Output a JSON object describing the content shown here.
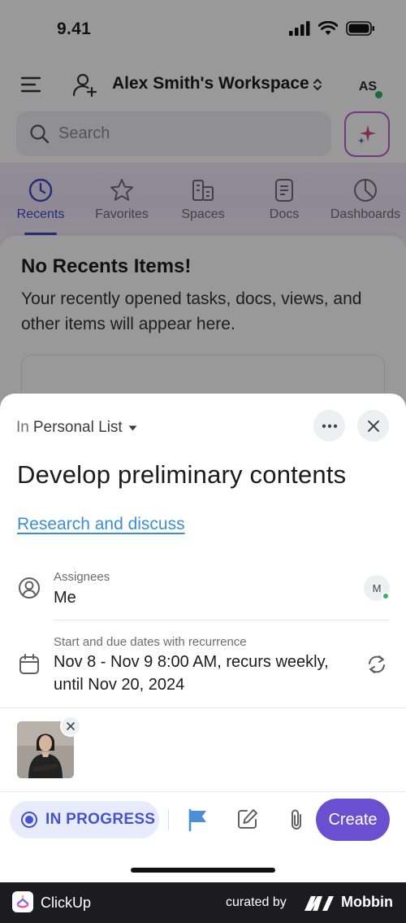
{
  "status_bar": {
    "time": "9.41"
  },
  "workspace": {
    "name": "Alex Smith's Workspace",
    "avatar_initials": "AS"
  },
  "search": {
    "placeholder": "Search"
  },
  "tabs": [
    {
      "label": "Recents",
      "icon": "clock-icon",
      "active": true
    },
    {
      "label": "Favorites",
      "icon": "star-icon",
      "active": false
    },
    {
      "label": "Spaces",
      "icon": "spaces-icon",
      "active": false
    },
    {
      "label": "Docs",
      "icon": "doc-icon",
      "active": false
    },
    {
      "label": "Dashboards",
      "icon": "pie-chart-icon",
      "active": false
    }
  ],
  "recents": {
    "empty_title": "No Recents Items!",
    "empty_description": "Your recently opened tasks, docs, views, and other items will appear here."
  },
  "sheet": {
    "location_prefix": "In",
    "location_name": "Personal List",
    "task_title": "Develop preliminary contents",
    "task_link": "Research and discuss",
    "assignees": {
      "label": "Assignees",
      "value": "Me",
      "avatar_initial": "M"
    },
    "dates": {
      "label": "Start and due dates with recurrence",
      "line1": "Nov 8 - Nov 9 8:00 AM, recurs weekly,",
      "line2": "until Nov 20, 2024"
    },
    "status": "IN PROGRESS",
    "create_label": "Create"
  },
  "footer": {
    "app_name": "ClickUp",
    "curated_by": "curated by",
    "brand": "Mobbin"
  },
  "colors": {
    "accent": "#4454d1",
    "create": "#6a4fd0",
    "link": "#3b8fd6",
    "online": "#2fb16a"
  }
}
